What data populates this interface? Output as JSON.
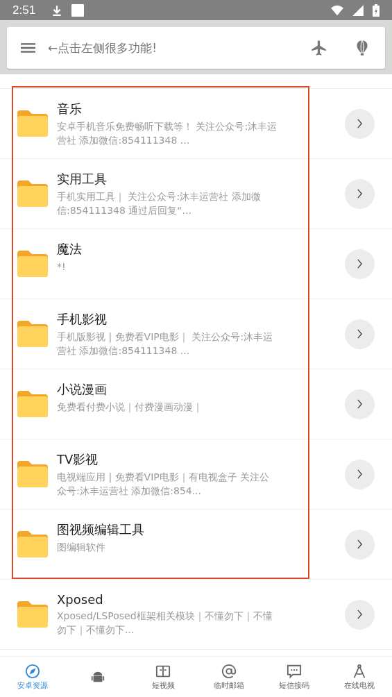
{
  "status_bar": {
    "time": "2:51"
  },
  "search": {
    "placeholder": "←点击左侧很多功能!"
  },
  "highlighted_items": [
    {
      "title": "音乐",
      "desc": "安卓手机音乐免费畅听下载等！ 关注公众号:沐丰运营社 添加微信:854111348 ..."
    },
    {
      "title": "实用工具",
      "desc": "手机实用工具｜ 关注公众号:沐丰运营社 添加微信:854111348 通过后回复“..."
    },
    {
      "title": "魔法",
      "desc": "*!"
    },
    {
      "title": "手机影视",
      "desc": "手机版影视 | 免费看VIP电影｜ 关注公众号:沐丰运营社 添加微信:854111348 ..."
    },
    {
      "title": "小说漫画",
      "desc": "免费看付费小说｜付费漫画动漫｜"
    },
    {
      "title": "TV影视",
      "desc": "电视端应用 | 免费看VIP电影｜有电视盒子 关注公众号:沐丰运营社 添加微信:854..."
    },
    {
      "title": "图视频编辑工具",
      "desc": "图编辑软件"
    }
  ],
  "items": [
    {
      "title": "Xposed",
      "desc": "Xposed/LSPosed框架相关模块｜不懂勿下｜不懂勿下｜不懂勿下..."
    }
  ],
  "nav": [
    {
      "kind": "compass",
      "label": "安卓资源",
      "selected": true
    },
    {
      "kind": "android",
      "selected": false
    },
    {
      "kind": "video",
      "label": "短视频",
      "selected": false
    },
    {
      "kind": "email",
      "label": "临时邮箱",
      "selected": false
    },
    {
      "kind": "sms",
      "label": "短信接码",
      "selected": false
    },
    {
      "kind": "tv",
      "label": "在线电视",
      "selected": false
    }
  ]
}
